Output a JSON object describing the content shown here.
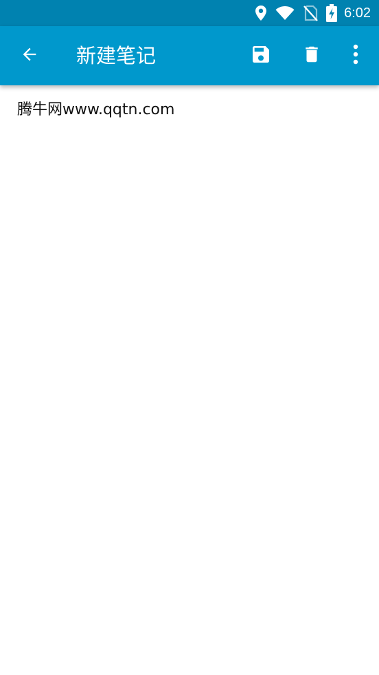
{
  "status_bar": {
    "time": "6:02",
    "icons": [
      "location-icon",
      "wifi-icon",
      "no-sim-icon",
      "battery-charging-icon"
    ],
    "background_color": "#0082b0"
  },
  "app_bar": {
    "title": "新建笔记",
    "background_color": "#0098cc",
    "actions": [
      "arrow-back-icon",
      "save-icon",
      "delete-icon",
      "more-vert-icon"
    ]
  },
  "editor": {
    "text": "腾牛网www.qqtn.com"
  }
}
